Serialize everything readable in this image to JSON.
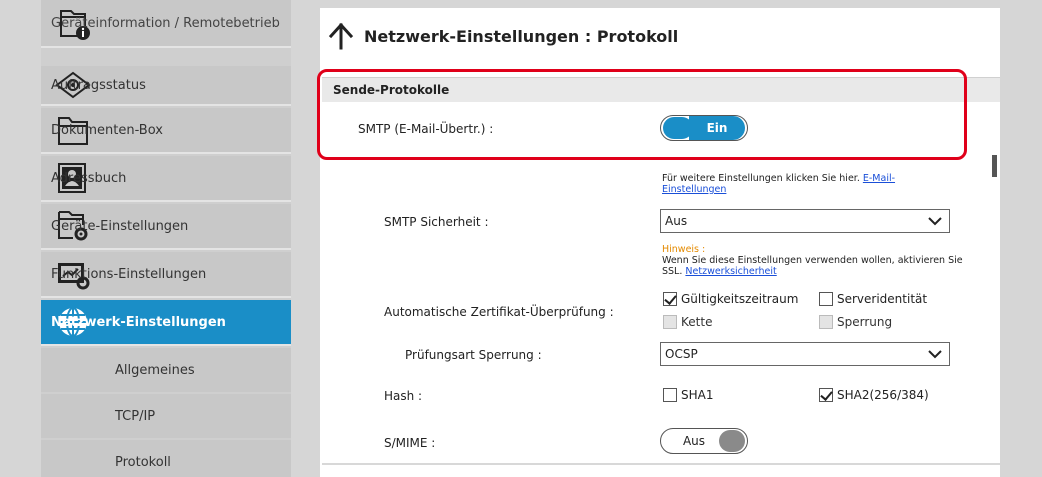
{
  "sidebar": {
    "items": [
      {
        "label": "Geräteinformation / Remotebetrieb",
        "icon": "device-info-icon"
      },
      {
        "label": "Auftragsstatus",
        "icon": "eye-icon"
      },
      {
        "label": "Dokumenten-Box",
        "icon": "folder-icon"
      },
      {
        "label": "Adressbuch",
        "icon": "address-book-icon"
      },
      {
        "label": "Geräte-Einstellungen",
        "icon": "device-settings-icon"
      },
      {
        "label": "Funktions-Einstellungen",
        "icon": "function-settings-icon"
      },
      {
        "label": "Netzwerk-Einstellungen",
        "icon": "globe-icon",
        "active": true
      }
    ],
    "sub_items": [
      {
        "label": "Allgemeines"
      },
      {
        "label": "TCP/IP"
      },
      {
        "label": "Protokoll"
      }
    ]
  },
  "main": {
    "title": "Netzwerk-Einstellungen : Protokoll",
    "section_title": "Sende-Protokolle",
    "smtp_label": "SMTP (E-Mail-Übertr.) :",
    "smtp_toggle": "Ein",
    "email_note": "Für weitere Einstellungen klicken Sie hier.",
    "email_link": "E-Mail-Einstellungen",
    "smtp_security_label": "SMTP Sicherheit :",
    "smtp_security_value": "Aus",
    "hint_title": "Hinweis :",
    "hint_text": "Wenn Sie diese Einstellungen verwenden wollen, aktivieren Sie SSL.",
    "hint_link": "Netzwerksicherheit",
    "cert_check_label": "Automatische Zertifikat-Überprüfung :",
    "cert_options": [
      {
        "label": "Gültigkeitszeitraum",
        "checked": true,
        "disabled": false
      },
      {
        "label": "Serveridentität",
        "checked": false,
        "disabled": false
      },
      {
        "label": "Kette",
        "checked": false,
        "disabled": true
      },
      {
        "label": "Sperrung",
        "checked": false,
        "disabled": true
      }
    ],
    "revocation_label": "Prüfungsart Sperrung :",
    "revocation_value": "OCSP",
    "hash_label": "Hash :",
    "hash_options": [
      {
        "label": "SHA1",
        "checked": false
      },
      {
        "label": "SHA2(256/384)",
        "checked": true
      }
    ],
    "smime_label": "S/MIME :",
    "smime_toggle": "Aus"
  },
  "colors": {
    "accent": "#1a8ec7",
    "highlight": "#e0001a",
    "hint": "#e48a00",
    "link": "#1a4fd8"
  }
}
